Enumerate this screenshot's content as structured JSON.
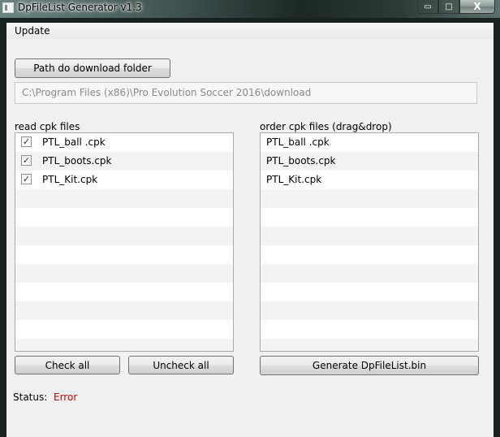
{
  "window": {
    "title": "DpFileList Generator v1.3",
    "controls": {
      "minimize": "▭",
      "maximize": "□",
      "close": "X"
    }
  },
  "menu": {
    "items": [
      {
        "label": "Update"
      }
    ]
  },
  "download": {
    "button_label": "Path do download folder",
    "path_value": "C:\\Program Files (x86)\\Pro Evolution Soccer 2016\\download"
  },
  "read_list": {
    "label": "read cpk files",
    "items": [
      {
        "name": "PTL_ball .cpk",
        "checked": "✓"
      },
      {
        "name": "PTL_boots.cpk",
        "checked": "✓"
      },
      {
        "name": "PTL_Kit.cpk",
        "checked": "✓"
      }
    ]
  },
  "order_list": {
    "label": "order cpk files (drag&drop)",
    "items": [
      {
        "name": "PTL_ball .cpk"
      },
      {
        "name": "PTL_boots.cpk"
      },
      {
        "name": "PTL_Kit.cpk"
      }
    ]
  },
  "buttons": {
    "check_all": "Check all",
    "uncheck_all": "Uncheck all",
    "generate": "Generate DpFileList.bin"
  },
  "status": {
    "label": "Status:",
    "value": "Error",
    "value_color": "#c00000"
  }
}
